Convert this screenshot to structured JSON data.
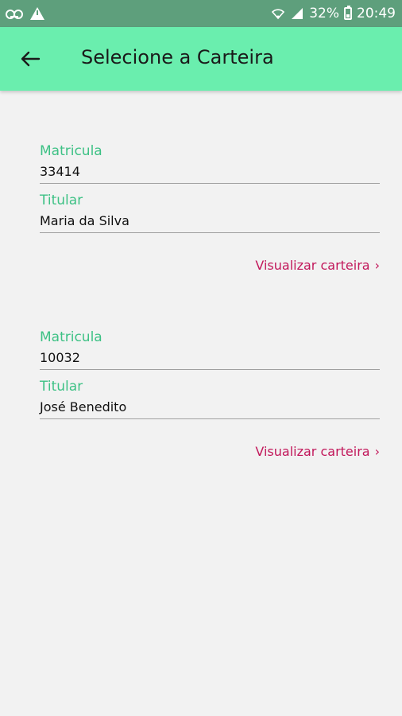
{
  "status_bar": {
    "battery_percent": "32%",
    "time": "20:49",
    "icons": [
      "voicemail-icon",
      "warning-icon",
      "wifi-icon",
      "signal-icon",
      "battery-icon"
    ]
  },
  "toolbar": {
    "back_icon": "arrow-left-icon",
    "title": "Selecione a Carteira",
    "background": "#6aeeae"
  },
  "wallets": [
    {
      "matricula_label": "Matricula",
      "matricula": "33414",
      "titular_label": "Titular",
      "titular": "Maria da Silva",
      "link_label": "Visualizar carteira"
    },
    {
      "matricula_label": "Matricula",
      "matricula": "10032",
      "titular_label": "Titular",
      "titular": "José Benedito",
      "link_label": "Visualizar carteira"
    }
  ],
  "colors": {
    "label": "#3ec185",
    "link": "#c2185b",
    "status_bar": "#5e9f7c"
  }
}
